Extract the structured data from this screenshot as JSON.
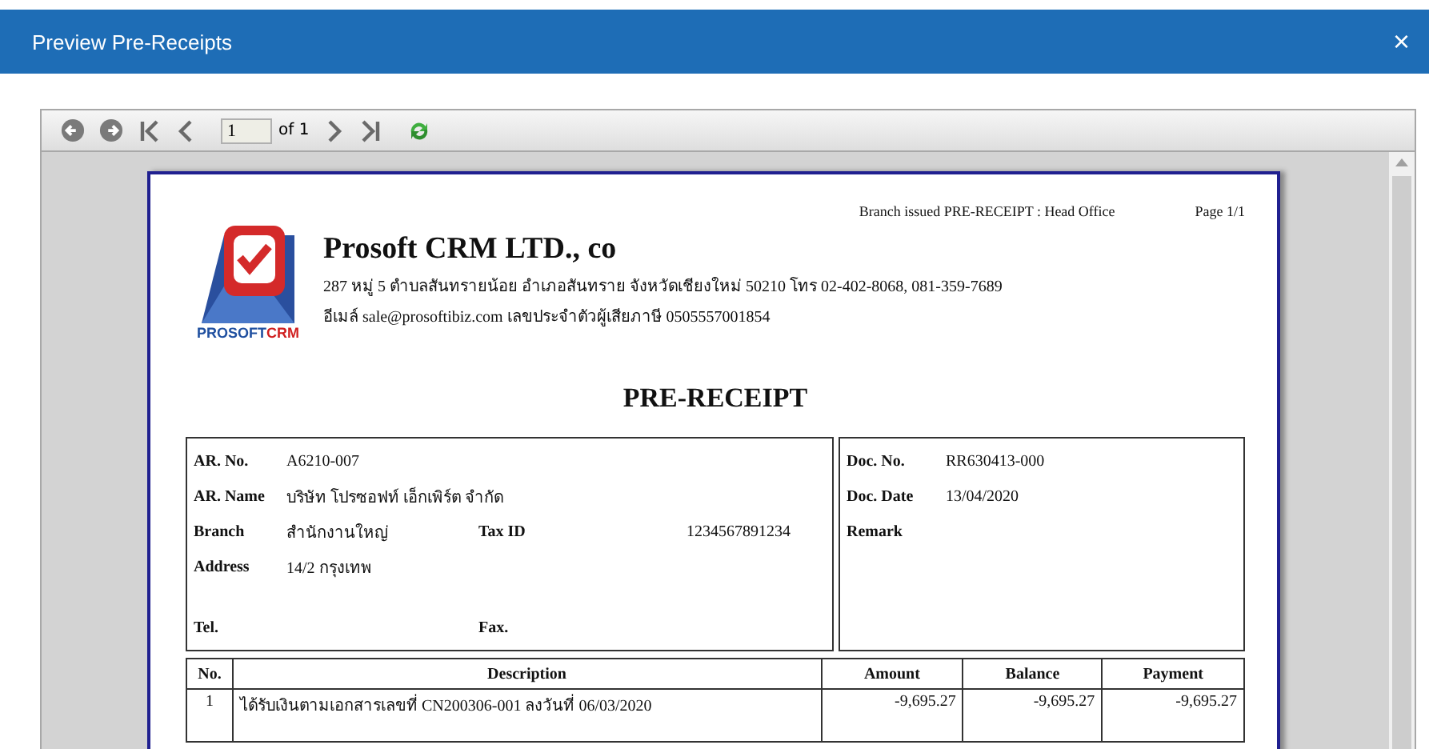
{
  "window": {
    "title": "Preview Pre-Receipts",
    "close": "×"
  },
  "toolbar": {
    "page_input": "1",
    "page_count": "of 1"
  },
  "report": {
    "branch_issued": "Branch issued PRE-RECEIPT : Head Office",
    "page": "Page 1/1",
    "logo": {
      "word1": "PROSOFT",
      "word2": "CRM"
    },
    "company": "Prosoft CRM LTD., co",
    "address_lines": [
      "287 หมู่ 5 ตำบลสันทรายน้อย อำเภอสันทราย จังหวัดเชียงใหม่ 50210 โทร 02-402-8068, 081-359-7689",
      "อีเมล์ sale@prosoftibiz.com เลขประจำตัวผู้เสียภาษี 0505557001854"
    ],
    "title": "PRE-RECEIPT",
    "customer": [
      {
        "label": "AR. No.",
        "value": "A6210-007"
      },
      {
        "label": "AR. Name",
        "value": "บริษัท โปรซอฟท์ เอ็กเพิร์ต จำกัด"
      },
      {
        "label": "Branch",
        "value": "สำนักงานใหญ่",
        "label2": "Tax ID",
        "value2": "1234567891234"
      },
      {
        "label": "Address",
        "value": "14/2 กรุงเทพ"
      },
      {
        "label": "Tel.",
        "label2": "Fax."
      }
    ],
    "document": [
      {
        "label": "Doc. No.",
        "value": "RR630413-000"
      },
      {
        "label": "Doc. Date",
        "value": "13/04/2020"
      },
      {
        "label": "Remark"
      }
    ],
    "table": {
      "columns": [
        "No.",
        "Description",
        "Amount",
        "Balance",
        "Payment"
      ],
      "rows": [
        [
          "1",
          "ได้รับเงินตามเอกสารเลขที่ CN200306-001 ลงวันที่ 06/03/2020",
          "-9,695.27",
          "-9,695.27",
          "-9,695.27"
        ]
      ]
    }
  }
}
